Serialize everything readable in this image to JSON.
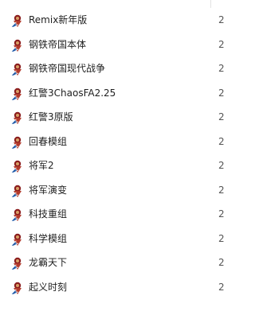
{
  "folder_list": {
    "items": [
      {
        "label": "Remix新年版",
        "count": "2",
        "icon": "game-shortcut-icon"
      },
      {
        "label": "钢铁帝国本体",
        "count": "2",
        "icon": "game-shortcut-icon"
      },
      {
        "label": "钢铁帝国现代战争",
        "count": "2",
        "icon": "game-shortcut-icon"
      },
      {
        "label": "红警3ChaosFA2.25",
        "count": "2",
        "icon": "game-shortcut-icon"
      },
      {
        "label": "红警3原版",
        "count": "2",
        "icon": "game-shortcut-icon"
      },
      {
        "label": "回春模组",
        "count": "2",
        "icon": "game-shortcut-icon"
      },
      {
        "label": "将军2",
        "count": "2",
        "icon": "game-shortcut-icon"
      },
      {
        "label": "将军演变",
        "count": "2",
        "icon": "game-shortcut-icon"
      },
      {
        "label": "科技重组",
        "count": "2",
        "icon": "game-shortcut-icon"
      },
      {
        "label": "科学模组",
        "count": "2",
        "icon": "game-shortcut-icon"
      },
      {
        "label": "龙霸天下",
        "count": "2",
        "icon": "game-shortcut-icon"
      },
      {
        "label": "起义时刻",
        "count": "2",
        "icon": "game-shortcut-icon"
      }
    ]
  },
  "colors": {
    "text": "#1f1f1f",
    "count_text": "#555555",
    "background": "#ffffff",
    "icon_primary": "#8b1e1e",
    "icon_secondary": "#d9a066"
  }
}
